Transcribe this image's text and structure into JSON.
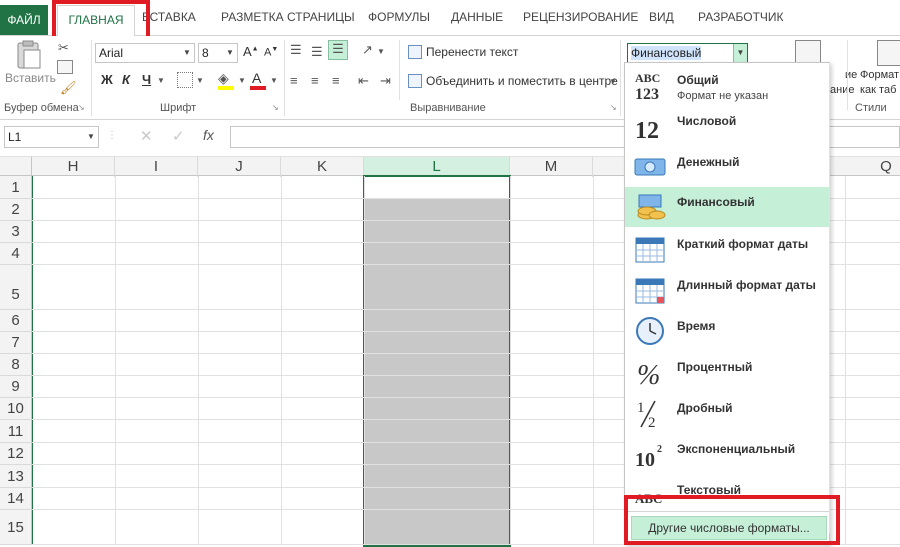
{
  "tabs": {
    "file": "ФАЙЛ",
    "home": "ГЛАВНАЯ",
    "insert": "ВСТАВКА",
    "page_layout": "РАЗМЕТКА СТРАНИЦЫ",
    "formulas": "ФОРМУЛЫ",
    "data": "ДАННЫЕ",
    "review": "РЕЦЕНЗИРОВАНИЕ",
    "view": "ВИД",
    "developer": "РАЗРАБОТЧИК"
  },
  "ribbon": {
    "paste_label": "Вставить",
    "clipboard_group": "Буфер обмена",
    "font_group": "Шрифт",
    "alignment_group": "Выравнивание",
    "styles_group": "Стили",
    "font_name": "Arial",
    "font_size": "8",
    "bold": "Ж",
    "italic": "К",
    "underline": "Ч",
    "wrap_text": "Перенести текст",
    "merge_center": "Объединить и поместить в центре",
    "number_format": "Финансовый",
    "cond_format_partial": "ие",
    "cond_format_partial2": "ание",
    "format_table": "Формат",
    "format_table2": "как таб"
  },
  "formula_bar": {
    "name_box": "L1",
    "fx": "fx",
    "value": ""
  },
  "grid": {
    "columns": [
      "H",
      "I",
      "J",
      "K",
      "L",
      "M",
      "Q"
    ],
    "rows": [
      "1",
      "2",
      "3",
      "4",
      "5",
      "6",
      "7",
      "8",
      "9",
      "10",
      "11",
      "12",
      "13",
      "14",
      "15"
    ]
  },
  "number_formats": {
    "items": [
      {
        "label": "Общий",
        "sub": "Формат не указан",
        "icon": "abc-123-icon"
      },
      {
        "label": "Числовой",
        "icon": "number-12-icon"
      },
      {
        "label": "Денежный",
        "icon": "money-icon"
      },
      {
        "label": "Финансовый",
        "icon": "coins-icon"
      },
      {
        "label": "Краткий формат даты",
        "icon": "calendar-icon"
      },
      {
        "label": "Длинный формат даты",
        "icon": "calendar-icon"
      },
      {
        "label": "Время",
        "icon": "clock-icon"
      },
      {
        "label": "Процентный",
        "icon": "percent-icon"
      },
      {
        "label": "Дробный",
        "icon": "fraction-icon"
      },
      {
        "label": "Экспоненциальный",
        "icon": "exponent-icon"
      },
      {
        "label": "Текстовый",
        "icon": "abc-text-icon"
      }
    ],
    "more": "Другие числовые форматы..."
  },
  "colors": {
    "accent_green": "#217346",
    "selected_item": "#c6efd8",
    "highlight_red": "#e01b24",
    "selection_fill": "#c8c8c8"
  }
}
